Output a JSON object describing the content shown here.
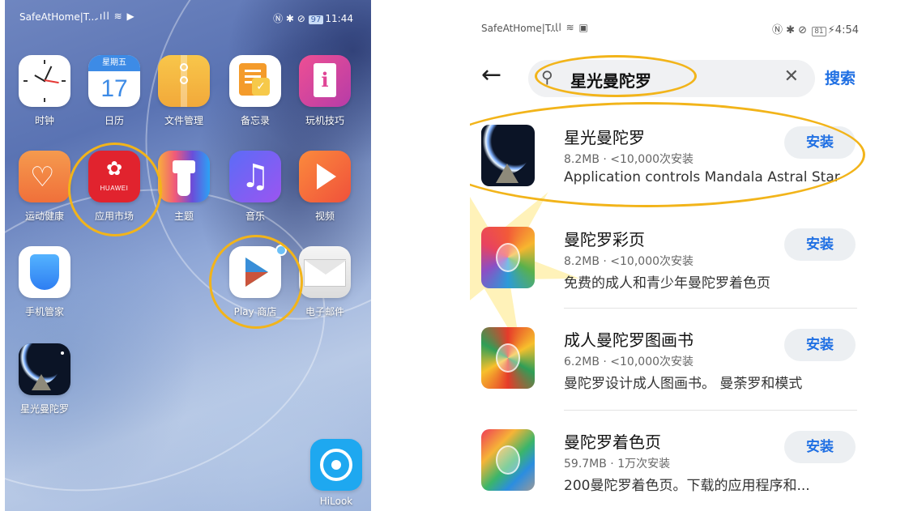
{
  "left_phone": {
    "status": {
      "carrier": "SafeAtHome|T...",
      "battery": "97",
      "time": "11:44"
    },
    "apps": [
      {
        "label": "时钟",
        "icon": "clock-icon"
      },
      {
        "label": "日历",
        "icon": "calendar-icon",
        "weekday": "星期五",
        "day": "17"
      },
      {
        "label": "文件管理",
        "icon": "files-icon"
      },
      {
        "label": "备忘录",
        "icon": "notes-icon"
      },
      {
        "label": "玩机技巧",
        "icon": "tips-icon"
      },
      {
        "label": "运动健康",
        "icon": "health-icon"
      },
      {
        "label": "应用市场",
        "icon": "app-gallery-icon",
        "brand": "HUAWEI"
      },
      {
        "label": "主题",
        "icon": "theme-brush-icon"
      },
      {
        "label": "音乐",
        "icon": "music-note-icon"
      },
      {
        "label": "视频",
        "icon": "video-play-icon"
      },
      {
        "label": "手机管家",
        "icon": "shield-icon"
      },
      {
        "label": "Play 商店",
        "icon": "play-store-icon"
      },
      {
        "label": "电子邮件",
        "icon": "mail-envelope-icon"
      },
      {
        "label": "星光曼陀罗",
        "icon": "astral-moon-icon"
      },
      {
        "label": "HiLook",
        "icon": "hilook-camera-icon"
      }
    ]
  },
  "right_phone": {
    "status": {
      "carrier": "SafeAtHome|T...",
      "battery": "81",
      "time": "4:54"
    },
    "search": {
      "query": "星光曼陀罗",
      "button": "搜索"
    },
    "results": [
      {
        "name": "星光曼陀罗",
        "meta": "8.2MB · <10,000次安装",
        "desc": "Application controls Mandala Astral Star",
        "action": "安装"
      },
      {
        "name": "曼陀罗彩页",
        "meta": "8.2MB · <10,000次安装",
        "desc": "免费的成人和青少年曼陀罗着色页",
        "action": "安装"
      },
      {
        "name": "成人曼陀罗图画书",
        "meta": "6.2MB · <10,000次安装",
        "desc": "曼陀罗设计成人图画书。 曼荼罗和模式",
        "action": "安装"
      },
      {
        "name": "曼陀罗着色页",
        "meta": "59.7MB · 1万次安装",
        "desc": "200曼陀罗着色页。下载的应用程序和...",
        "action": "安装"
      }
    ]
  },
  "colors": {
    "highlight": "#f2b41a",
    "accent_blue": "#1f6fe3"
  }
}
